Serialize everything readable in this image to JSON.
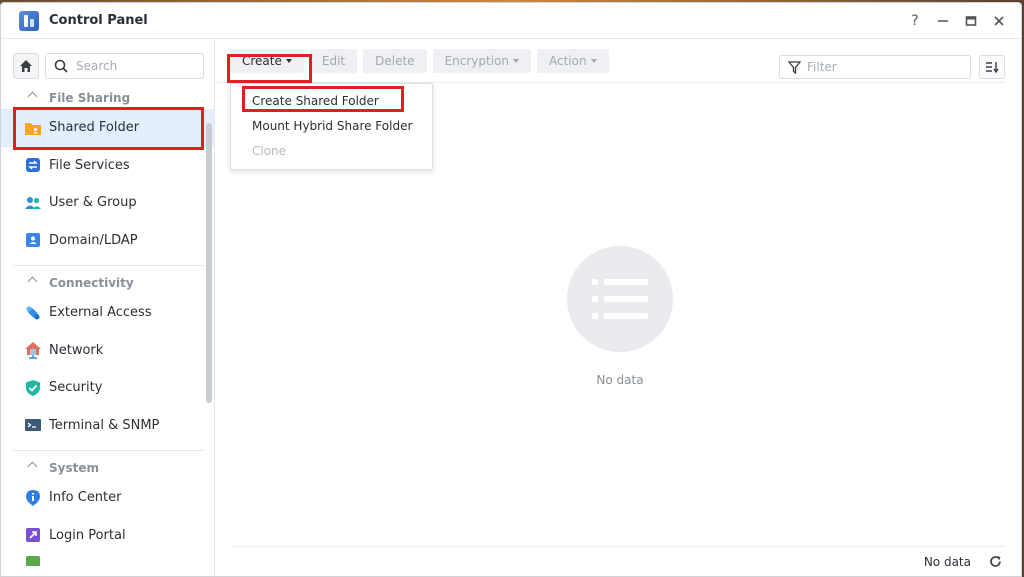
{
  "window": {
    "title": "Control Panel",
    "controls": {
      "help": "?",
      "minimize": "—",
      "maximize": "▭",
      "close": "✕"
    }
  },
  "sidebar": {
    "search_placeholder": "Search",
    "sections": [
      {
        "title": "File Sharing",
        "items": [
          "Shared Folder",
          "File Services",
          "User & Group",
          "Domain/LDAP"
        ]
      },
      {
        "title": "Connectivity",
        "items": [
          "External Access",
          "Network",
          "Security",
          "Terminal & SNMP"
        ]
      },
      {
        "title": "System",
        "items": [
          "Info Center",
          "Login Portal"
        ]
      }
    ],
    "active_item": "Shared Folder"
  },
  "toolbar": {
    "create": "Create",
    "edit": "Edit",
    "delete": "Delete",
    "encryption": "Encryption",
    "action": "Action",
    "filter_placeholder": "Filter"
  },
  "create_menu": {
    "items": [
      {
        "label": "Create Shared Folder",
        "enabled": true
      },
      {
        "label": "Mount Hybrid Share Folder",
        "enabled": true
      },
      {
        "label": "Clone",
        "enabled": false
      }
    ]
  },
  "main": {
    "empty_text": "No data",
    "footer_text": "No data"
  },
  "colors": {
    "highlight": "#e02020",
    "active_bg": "#e3efff",
    "accent": "#2d6fd6"
  }
}
